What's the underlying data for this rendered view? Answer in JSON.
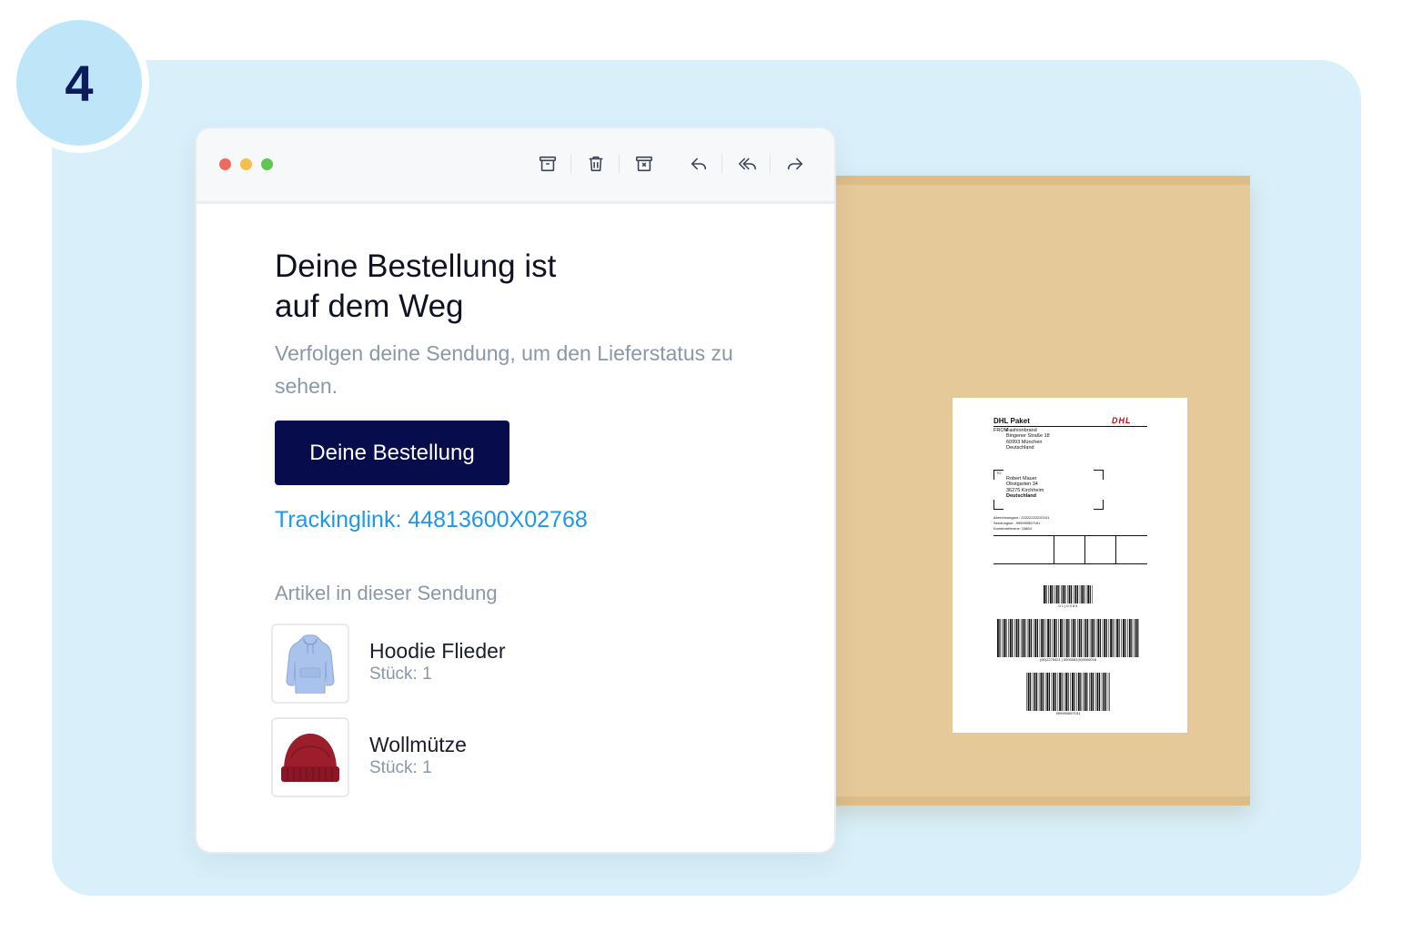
{
  "step": {
    "number": "4"
  },
  "window": {
    "traffic_lights": [
      "#ec6a5e",
      "#f4bf4f",
      "#61c554"
    ],
    "toolbar_icons": [
      "archive-icon",
      "trash-icon",
      "spam-icon",
      "reply-icon",
      "reply-all-icon",
      "forward-icon"
    ]
  },
  "email": {
    "headline_line1": "Deine Bestellung ist",
    "headline_line2": "auf dem Weg",
    "subtext": "Verfolgen deine Sendung, um den Lieferstatus zu sehen.",
    "cta_label": "Deine Bestellung",
    "tracking_link": "Trackinglink: 44813600X02768",
    "items_heading": "Artikel in dieser Sendung",
    "items": [
      {
        "name": "Hoodie Flieder",
        "quantity": "Stück: 1",
        "image": "hoodie-image"
      },
      {
        "name": "Wollmütze",
        "quantity": "Stück: 1",
        "image": "beanie-image"
      }
    ]
  },
  "shipping_label": {
    "title": "DHL Paket",
    "logo_text": "DHL",
    "from_label": "FROM",
    "from_lines": [
      "Fashionbrand",
      "Bingener Straße 18",
      "60993 München",
      "Deutschland"
    ],
    "to_label": "TO",
    "to_lines": [
      "Robert Mauer",
      "Obstgarten 34",
      "36275 Kirchheim",
      "Deutschland"
    ],
    "ref_lines": [
      "Abrechnungsnr.: 22222222220101",
      "Sendungsnr.: 999999557151",
      "Kundenreferenz: 10864"
    ],
    "barcode1_caption": "0 1 | 0 0 8 4",
    "barcode2_caption": "(00)2275421 | 0000081(0)9000018",
    "barcode3_caption": "999990557151"
  },
  "colors": {
    "panel_bg": "#d9f0fa",
    "badge_bg": "#bfe6f8",
    "cta_bg": "#070c4d",
    "link": "#1f96e8",
    "package": "#e6c999",
    "dhl_red": "#d40511"
  }
}
